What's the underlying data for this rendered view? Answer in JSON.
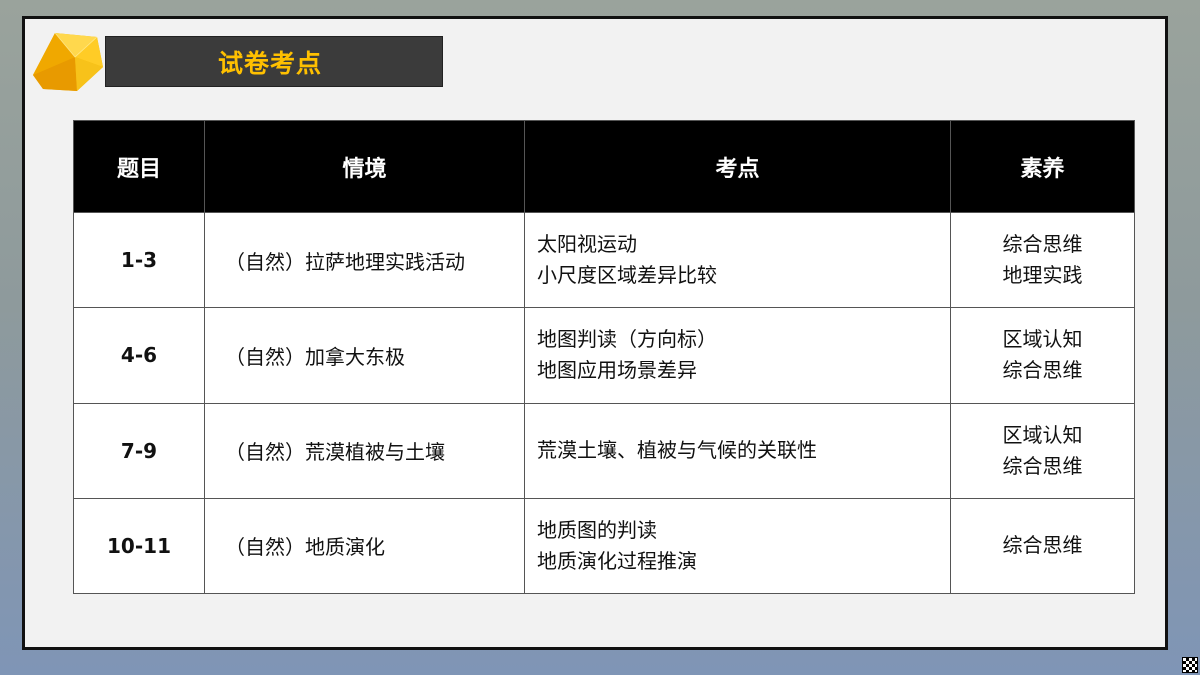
{
  "header": {
    "title": "试卷考点",
    "accent_color": "#ffc000",
    "bar_color": "#3b3b3b"
  },
  "table": {
    "headers": [
      "题目",
      "情境",
      "考点",
      "素养"
    ],
    "rows": [
      {
        "num": "1-3",
        "context": "（自然）拉萨地理实践活动",
        "points": [
          "太阳视运动",
          "小尺度区域差异比较"
        ],
        "literacy": [
          "综合思维",
          "地理实践"
        ]
      },
      {
        "num": "4-6",
        "context": "（自然）加拿大东极",
        "points": [
          "地图判读（方向标）",
          "地图应用场景差异"
        ],
        "literacy": [
          "区域认知",
          "综合思维"
        ]
      },
      {
        "num": "7-9",
        "context": "（自然）荒漠植被与土壤",
        "points": [
          "荒漠土壤、植被与气候的关联性"
        ],
        "literacy": [
          "区域认知",
          "综合思维"
        ]
      },
      {
        "num": "10-11",
        "context": "（自然）地质演化",
        "points": [
          "地质图的判读",
          "地质演化过程推演"
        ],
        "literacy": [
          "综合思维"
        ]
      }
    ]
  },
  "icons": {
    "corner_logo": "gem-icon",
    "corner_code": "qr-code-icon"
  }
}
